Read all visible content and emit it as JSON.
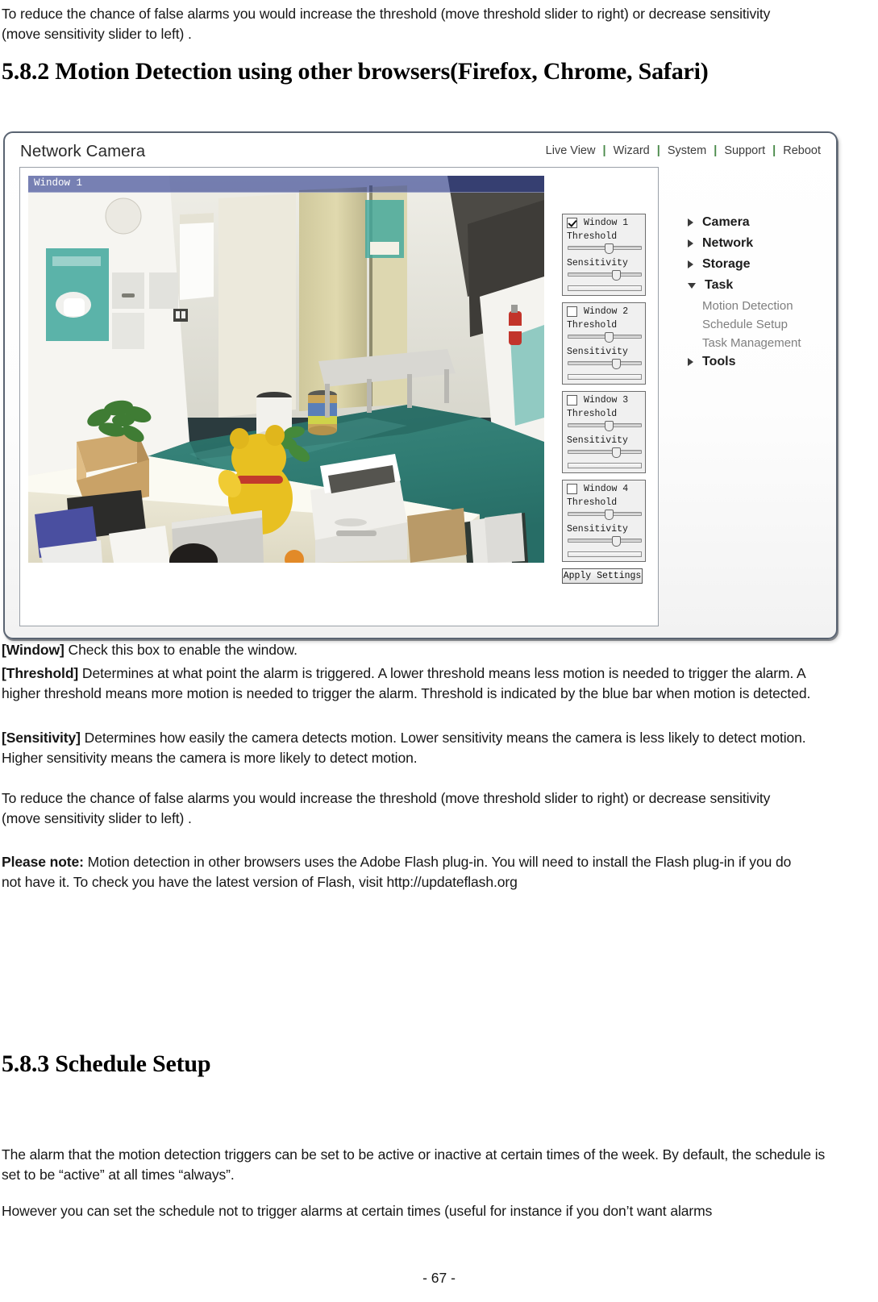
{
  "document": {
    "intro_paragraph": "To reduce the chance of false alarms you would increase the threshold (move threshold slider to right) or decrease sensitivity (move sensitivity slider to left) .",
    "heading_582": "5.8.2 Motion Detection using other browsers(Firefox, Chrome, Safari)",
    "window_term": "[Window]",
    "window_desc": " Check this box to enable the window.",
    "threshold_term": "[Threshold]",
    "threshold_desc": " Determines at what point the alarm is triggered. A lower threshold means less motion is needed to trigger the alarm. A higher threshold means more motion is needed to trigger the alarm. Threshold is indicated by the blue bar when motion is detected.",
    "sensitivity_term": "[Sensitivity]",
    "sensitivity_desc": " Determines how easily the camera detects motion. Lower sensitivity means the camera is less likely to detect motion. Higher sensitivity means the camera is more likely to detect motion.",
    "reduce_paragraph": "To reduce the chance of false alarms you would increase the threshold (move threshold slider to right) or decrease sensitivity (move sensitivity slider to left) .",
    "note_term": "Please note:",
    "note_desc": " Motion detection in other browsers uses the Adobe Flash plug-in. You will need to install the Flash plug-in if you do not have it. To check you have the latest version of Flash, visit http://updateflash.org",
    "heading_583": "5.8.3 Schedule Setup",
    "schedule_paragraph_1": "The alarm that the motion detection triggers can be set to be active or inactive at certain times of the week. By default, the schedule is set to be “active” at all times “always”.",
    "schedule_paragraph_2": "However you can set the schedule not to trigger alarms at certain times (useful for instance if you don’t want alarms",
    "page_number": "- 67 -"
  },
  "camera_ui": {
    "title": "Network Camera",
    "topnav": [
      {
        "label": "Live View"
      },
      {
        "label": "Wizard"
      },
      {
        "label": "System"
      },
      {
        "label": "Support"
      },
      {
        "label": "Reboot"
      }
    ],
    "topnav_separator": "|",
    "video": {
      "overlay_label": "Window 1",
      "detection_bar_color": "#28388c"
    },
    "windows": [
      {
        "name": "Window 1",
        "checked": true,
        "threshold_label": "Threshold",
        "sensitivity_label": "Sensitivity",
        "threshold_value": 55,
        "sensitivity_value": 66
      },
      {
        "name": "Window 2",
        "checked": false,
        "threshold_label": "Threshold",
        "sensitivity_label": "Sensitivity",
        "threshold_value": 55,
        "sensitivity_value": 66
      },
      {
        "name": "Window 3",
        "checked": false,
        "threshold_label": "Threshold",
        "sensitivity_label": "Sensitivity",
        "threshold_value": 55,
        "sensitivity_value": 66
      },
      {
        "name": "Window 4",
        "checked": false,
        "threshold_label": "Threshold",
        "sensitivity_label": "Sensitivity",
        "threshold_value": 55,
        "sensitivity_value": 66
      }
    ],
    "apply_button_label": "Apply Settings",
    "nav_tree": [
      {
        "label": "Camera",
        "expanded": false,
        "children": []
      },
      {
        "label": "Network",
        "expanded": false,
        "children": []
      },
      {
        "label": "Storage",
        "expanded": false,
        "children": []
      },
      {
        "label": "Task",
        "expanded": true,
        "children": [
          {
            "label": "Motion Detection"
          },
          {
            "label": "Schedule Setup"
          },
          {
            "label": "Task Management"
          }
        ]
      },
      {
        "label": "Tools",
        "expanded": false,
        "children": []
      }
    ]
  }
}
